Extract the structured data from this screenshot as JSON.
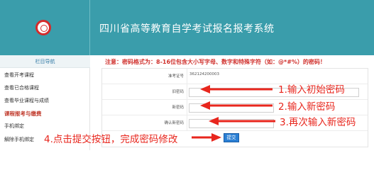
{
  "header": {
    "title": "四川省高等教育自学考试报名报考系统",
    "brand_color": "#3a9dab"
  },
  "sidebar": {
    "heading": "栏目导航",
    "items": [
      {
        "label": "查看开考课程",
        "active": false
      },
      {
        "label": "查看已合格课程",
        "active": false
      },
      {
        "label": "查看毕业课程与成绩",
        "active": false
      },
      {
        "label": "课程报考与缴费",
        "active": true
      },
      {
        "label": "手机绑定",
        "active": false
      },
      {
        "label": "解除手机绑定",
        "active": false
      }
    ]
  },
  "main": {
    "notice": "注意：密码格式为：8-16位包含大小写字母、数字和特殊字符（如：@*#%）的密码！",
    "form": {
      "rows": [
        {
          "label": "准考证号",
          "value": "362124200003"
        },
        {
          "label": "旧密码",
          "value": ""
        },
        {
          "label": "新密码",
          "value": ""
        },
        {
          "label": "确认新密码",
          "value": ""
        }
      ],
      "submit_label": "提交"
    }
  },
  "annotations": {
    "step1": "1.输入初始密码",
    "step2": "2.输入新密码",
    "step3": "3.再次输入新密码",
    "step4": "4.点击提交按钮，完成密码修改",
    "color": "#e8261d"
  }
}
